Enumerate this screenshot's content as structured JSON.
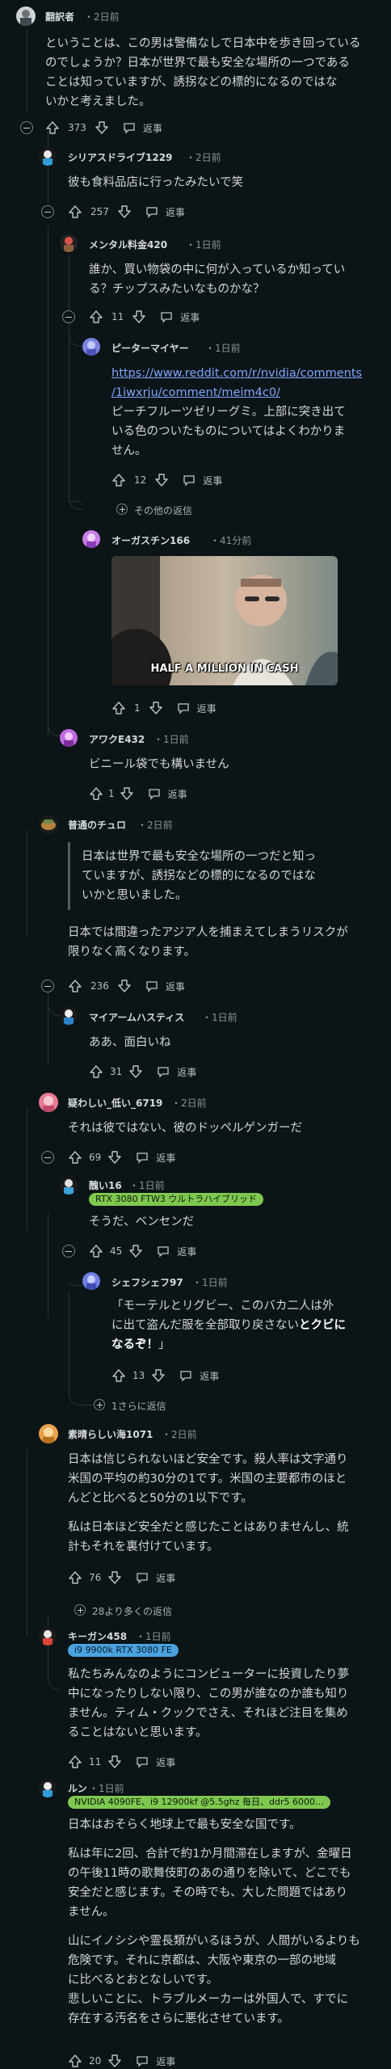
{
  "reply_label": "返事",
  "comments": [
    {
      "user": "翻訳者",
      "time": "・2日前",
      "lines": [
        "ということは、この男は警備なしで日本中を歩き回っている",
        "のでしょうか？日本が世界で最も安全な場所の一つである",
        "ことは知っていますが、誘拐などの標的になるのではな",
        "いかと考えました。"
      ],
      "votes": "373"
    },
    {
      "user": "シリアスドライブ1229",
      "time": "・2日前",
      "lines": [
        "彼も食料品店に行ったみたいで笑"
      ],
      "votes": "257"
    },
    {
      "user": "メンタル料金420",
      "time": "・1日前",
      "lines": [
        "誰か、買い物袋の中に何が入っているか知ってい",
        "る？チップスみたいなものかな？"
      ],
      "votes": "11"
    },
    {
      "user": "ピーターマイヤー",
      "time": "・1日前",
      "link_lines": [
        "https://www.reddit.com/r/nvidia/comments",
        "/1iwxrju/comment/meim4c0/"
      ],
      "lines": [
        "ピーチフルーツゼリーグミ。上部に突き出て",
        "いる色のついたものについてはよくわかりま",
        "せん。"
      ],
      "votes": "12",
      "more": "その他の返信"
    },
    {
      "user": "オーガスチン166",
      "time": "・41分前",
      "gif_caption": "HALF A MILLION IN CASH",
      "votes": "1"
    },
    {
      "user": "アワクE432",
      "time": "・1日前",
      "lines": [
        "ビニール袋でも構いません"
      ],
      "votes": "1"
    },
    {
      "user": "普通のチュロ",
      "time": "・2日前",
      "quote_lines": [
        "日本は世界で最も安全な場所の一つだと知っ",
        "ていますが、誘拐などの標的になるのではな",
        "いかと思いました。"
      ],
      "lines": [
        "日本では間違ったアジア人を捕まえてしまうリスクが",
        "限りなく高くなります。"
      ],
      "votes": "236"
    },
    {
      "user": "マイアームハスティス",
      "time": "・1日前",
      "lines": [
        "ああ、面白いね"
      ],
      "votes": "31"
    },
    {
      "user": "疑わしい_低い_6719",
      "time": "・2日前",
      "lines": [
        "それは彼ではない、彼のドッペルゲンガーだ"
      ],
      "votes": "69"
    },
    {
      "user": "醜い16",
      "time": "・1日前",
      "flair": "RTX 3080 FTW3 ウルトラハイブリッド",
      "lines": [
        "そうだ、ベンセンだ"
      ],
      "votes": "45"
    },
    {
      "user": "シェフシェフ97",
      "time": "・1日前",
      "lines": [
        "「モーテルとリグビー、このバカ二人は外",
        "に出て盗んだ服を全部取り戻さないとクビに",
        "なるぞ！」"
      ],
      "bold_part": "とクビに",
      "bold_line2": "なるぞ！",
      "votes": "13",
      "more": "1さらに返信"
    },
    {
      "user": "素晴らしい海1071",
      "time": "・2日前",
      "lines": [
        "日本は信じられないほど安全です。殺人率は文字通り",
        "米国の平均の約30分の1です。米国の主要都市のほと",
        "んどと比べると50分の1以下です。",
        "",
        "私は日本ほど安全だと感じたことはありませんし、統",
        "計もそれを裏付けています。"
      ],
      "votes": "76",
      "more": "28より多くの返信"
    },
    {
      "user": "キーガン458",
      "time": "・1日前",
      "flair": "i9 9900k RTX 3080 FE",
      "lines": [
        "私たちみんなのようにコンピューターに投資したり夢",
        "中になったりしない限り、この男が誰なのか誰も知り",
        "ません。ティム・クックでさえ、それほど注目を集め",
        "ることはないと思います。"
      ],
      "votes": "11"
    },
    {
      "user": "ルン",
      "time": "・1日前",
      "flair": "NVIDIA 4090FE、i9 12900kf @5.5ghz 毎日、ddr5 6000…",
      "lines": [
        "日本はおそらく地球上で最も安全な国です。",
        "",
        "私は年に2回、合計で約1か月間滞在しますが、金曜日",
        "の午後11時の歌舞伎町のあの通りを除いて、どこでも",
        "安全だと感じます。その時でも、大した問題ではあり",
        "ません。",
        "",
        "山にイノシシや霊長類がいるほうが、人間がいるよりも",
        "危険です。それに京都は、大阪や東京の一部の地域",
        "に比べるとおとなしいです。",
        "悲しいことに、トラブルメーカーは外国人で、すでに",
        "存在する汚名をさらに悪化させています。"
      ],
      "votes": "20"
    }
  ]
}
